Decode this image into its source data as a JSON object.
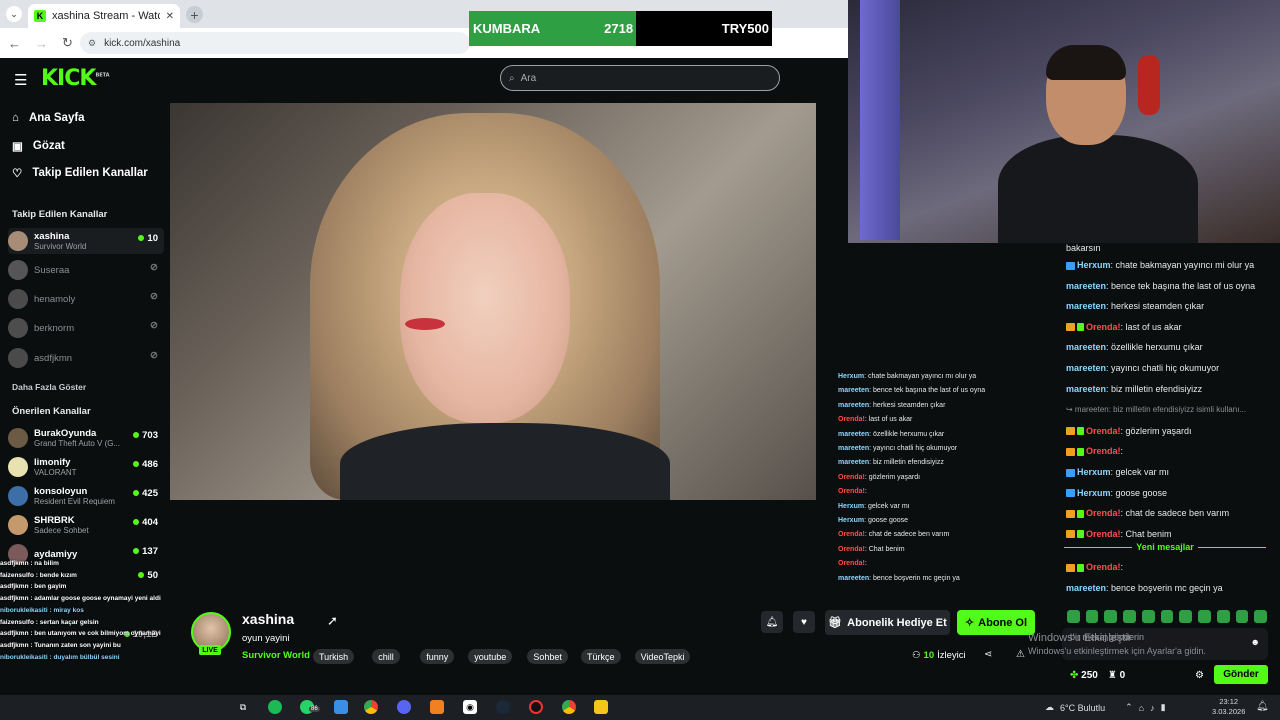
{
  "browser": {
    "tab_title": "xashina Stream - Watch Live on",
    "url": "kick.com/xashina",
    "new_tab_symbol": "+"
  },
  "kumbara": {
    "label": "KUMBARA",
    "value": "2718",
    "goal": "TRY500",
    "progress_fraction": 0.55,
    "color": "#2ea043"
  },
  "kick": {
    "logo": "KICK",
    "logo_badge": "BETA",
    "search_placeholder": "Ara",
    "accent_color": "#53fc18"
  },
  "sidebar": {
    "nav": [
      {
        "label": "Ana Sayfa",
        "icon": "home-icon"
      },
      {
        "label": "Gözat",
        "icon": "browse-icon"
      },
      {
        "label": "Takip Edilen Kanallar",
        "icon": "heart-icon"
      }
    ],
    "followed_heading": "Takip Edilen Kanallar",
    "followed": [
      {
        "name": "xashina",
        "game": "Survivor World",
        "viewers": "10",
        "live": true
      },
      {
        "name": "Suseraa",
        "game": "",
        "viewers": "",
        "live": false
      },
      {
        "name": "henamoly",
        "game": "",
        "viewers": "",
        "live": false
      },
      {
        "name": "berknorm",
        "game": "",
        "viewers": "",
        "live": false
      },
      {
        "name": "asdfjkmn",
        "game": "",
        "viewers": "",
        "live": false
      }
    ],
    "show_more": "Daha Fazla Göster",
    "recommended_heading": "Önerilen Kanallar",
    "recommended": [
      {
        "name": "BurakOyunda",
        "game": "Grand Theft Auto V (G...",
        "viewers": "703"
      },
      {
        "name": "limonify",
        "game": "VALORANT",
        "viewers": "486"
      },
      {
        "name": "konsoloyun",
        "game": "Resident Evil Requiem",
        "viewers": "425"
      },
      {
        "name": "SHRBRK",
        "game": "Sadece Sohbet",
        "viewers": "404"
      },
      {
        "name": "aydamiyy",
        "game": "",
        "viewers": "137"
      },
      {
        "name": "",
        "game": "",
        "viewers": "50"
      },
      {
        "name": "",
        "game": "",
        "viewers": "19,1B"
      }
    ]
  },
  "stream": {
    "name": "xashina",
    "title": "oyun yayini",
    "category": "Survivor World",
    "live_badge": "LIVE",
    "tags": [
      "Turkish",
      "chill",
      "funny",
      "youtube",
      "Sohbet",
      "Türkçe",
      "VideoTepki"
    ],
    "viewers_count": "10",
    "viewers_label": "İzleyici",
    "gift_button": "Abonelik Hediye Et",
    "subscribe_button": "Abone Ol"
  },
  "overlay_chat": [
    {
      "user": "Herxum",
      "text": ": chate bakmayan yayıncı mı olur ya"
    },
    {
      "user": "mareeten",
      "text": ": bence tek başına the last of us oyna"
    },
    {
      "user": "mareeten",
      "text": ": herkesi steamden çıkar"
    },
    {
      "user": "Orenda!",
      "text": ": last of us akar"
    },
    {
      "user": "mareeten",
      "text": ": özellikle herxumu çıkar"
    },
    {
      "user": "mareeten",
      "text": ": yayıncı chatli hiç okumuyor"
    },
    {
      "user": "mareeten",
      "text": ": biz milletin efendisiyizz"
    },
    {
      "user": "Orenda!",
      "text": ": gözlerim yaşardı"
    },
    {
      "user": "Orenda!",
      "text": ":"
    },
    {
      "user": "Herxum",
      "text": ": gelcek var mı"
    },
    {
      "user": "Herxum",
      "text": ": goose goose"
    },
    {
      "user": "Orenda!",
      "text": ": chat de sadece ben varım"
    },
    {
      "user": "Orenda!",
      "text": ": Chat benim"
    },
    {
      "user": "Orenda!",
      "text": ":"
    },
    {
      "user": "mareeten",
      "text": ": bence boşverin mc geçin ya"
    }
  ],
  "chat": {
    "top_text": "bakarsın",
    "messages": [
      {
        "user": "Herxum",
        "text": ": chate bakmayan yayıncı mi olur ya",
        "type": "blue"
      },
      {
        "user": "mareeten",
        "text": ": bence tek başına the last of us oyna",
        "type": "green"
      },
      {
        "user": "mareeten",
        "text": ": herkesi steamden çıkar",
        "type": "green"
      },
      {
        "user": "Orenda!",
        "text": ": last of us akar",
        "type": "red"
      },
      {
        "user": "mareeten",
        "text": ": özellikle herxumu çıkar",
        "type": "green"
      },
      {
        "user": "mareeten",
        "text": ": yayıncı chatli hiç okumuyor",
        "type": "green"
      },
      {
        "user": "mareeten",
        "text": ": biz milletin efendisiyizz",
        "type": "green"
      },
      {
        "user": "",
        "text": "↪ mareeten: biz milletin efendisiyizz isimli kullanı...",
        "type": "reply"
      },
      {
        "user": "Orenda!",
        "text": ": gözlerim yaşardı",
        "type": "red"
      },
      {
        "user": "Orenda!",
        "text": ":",
        "type": "red"
      },
      {
        "user": "Herxum",
        "text": ": gelcek var mı",
        "type": "blue"
      },
      {
        "user": "Herxum",
        "text": ": goose goose",
        "type": "blue"
      },
      {
        "user": "Orenda!",
        "text": ": chat de sadece ben varım",
        "type": "red"
      },
      {
        "user": "Orenda!",
        "text": ": Chat benim",
        "type": "red"
      }
    ],
    "new_messages_label": "Yeni mesajlar",
    "after_messages": [
      {
        "user": "Orenda!",
        "text": ":",
        "type": "red"
      },
      {
        "user": "mareeten",
        "text": ": bence boşverin mc geçin ya",
        "type": "green"
      }
    ],
    "input_placeholder": "bir mesaj gönderin",
    "points": "250",
    "count": "0",
    "send_button": "Gönder"
  },
  "windows_watermark": {
    "line1": "Windows'u Etkinleştir",
    "line2": "Windows'u etkinleştirmek için Ayarlar'a gidin."
  },
  "left_chat": [
    "asdfjkmn : na bilim",
    "faizensulfo : bende kızım",
    "asdfjkmn : ben gayim",
    "asdfjkmn : adamlar goose goose oynamayi yeni aldi",
    "niborukleikasiti : miray kos",
    "faizensulfo : sertan kaçar gelsin",
    "asdfjkmn : ben utanıyom ve cok bilmiyom oynamayi",
    "asdfjkmn : Tunanın zaten son yayini bu",
    "niborukleikasiti : duyalım bülbül sesini"
  ],
  "taskbar": {
    "weather": "6°C Bulutlu",
    "time": "23:12",
    "date": "3.03.2026",
    "badge_count": "86"
  }
}
